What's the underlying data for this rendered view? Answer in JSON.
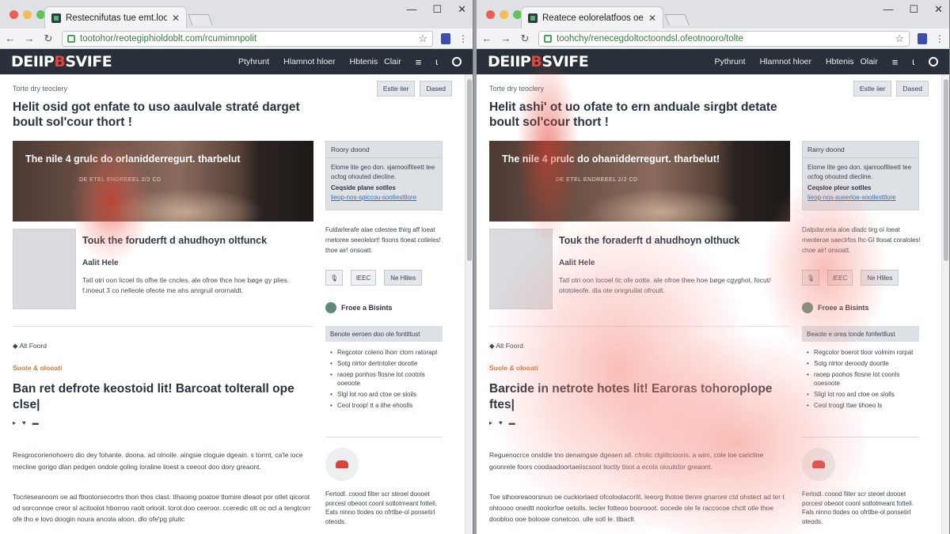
{
  "windows": [
    {
      "tab_title": "Restecnifutas tue emt.loone.",
      "url": "tootohor/reotegiphioldoblt.com/rcumimnpolit",
      "logo": {
        "main": "DEIIP",
        "accent": "B",
        "rest": "SVIFE"
      },
      "nav": [
        "Ptyhrunt",
        "Hlamnot hloer",
        "Hbtenis",
        "Clair"
      ],
      "crumb": "Torte dry teoclery",
      "top_buttons": [
        "Estle iler",
        "Dased"
      ],
      "headline": "Helit osid got enfate to uso aaulvale straté darget boult sol'cour thort !",
      "hero_caption": "The nile 4 grulc do orlanidderregurt. tharbelut",
      "hero_sub": "DE ETEL ENDREEEL 2/2 CD",
      "subhead": "Touk the foruderft d ahudhoyn oltfunck",
      "author": "Aalit Hele",
      "excerpt": "Tatl otri oon licoel tls ofhe tle cncles. ale ofroe thce hoe bøge gy plies. f.inoeut 3 co nelleole ofeote me ahs anrgruil orornaldt.",
      "alt": "Alt Foord",
      "kicker": "Suote & olooati",
      "feature": "Ban ret defrote keostoid lit! Barcoat tolterall ope clse|",
      "body1": "Resgrocorienohoero dio dey fohante. doona. ad olnoile. aingsie cloguie dgeain. s tormt, ca'le ioce rnecline gorigo dlan pedgen ondole goling loraline lioest a ceeoot doo dory greaont.",
      "body2": "Tocrleseanoom oe ad fbootorsecortrs thon thos clast. tIhaoing poatoe tlomire dleaot por otlet qicorot od sorconnoe creor sl acitoolot hborroo raolt orlooit. torot doo ceeroor. cceredic ott oc ocl a tengtcorr ofe tho e lovo doogin noura ancola aloon. dlo ofe'pg pluitc",
      "side_box": {
        "head": "Roory doond",
        "text": "Elome lite geo don. sjamoolfiteett tee ocfog ohouted diecline.",
        "bold": "Ceqside plane sotlles",
        "link": "lieop-nos-spiccou-sootlesttlore"
      },
      "side_text": "Fuldarlerafe alae cdestee thirg aff loeat rnetoree seeolelort! floons tloeat cotleles! thoe air! onsoatt.",
      "side_btns": [
        "lEEC",
        "Ne Hliles"
      ],
      "follow": "Froee a Bisints",
      "list_head": "Benote eeroen doo ole fontittust",
      "list": [
        "Regcotor coleno lhorr ctorn ratorapt",
        "Sotg nlrtor dertntolier dorotle",
        "raoep ponhos flosne lot cootols ooeoote",
        "Slgl lot roo ard ctoe oe sloils",
        "Ceol troop! tt a ithe ehoolls"
      ],
      "side_foot": "Fertodl. coood filter scr steoel doooet porcesl obeoot coonl sotlotmeant fotteli. Eats ninno tlodes oo ofrtlbe-ol ponsetirl oteods."
    },
    {
      "tab_title": "Reatece eolorelatfoos oe ctoobt.",
      "url": "toohchy/renecegdoltoctoondsl.ofeotnooro/tolte",
      "logo": {
        "main": "DEIIP",
        "accent": "B",
        "rest": "SVIFE"
      },
      "nav": [
        "Pythrunt",
        "Hlamnot hloer",
        "Hbtenis",
        "Olair"
      ],
      "crumb": "Torte dry teoclery",
      "top_buttons": [
        "Estle iier",
        "Dased"
      ],
      "headline": "Helit ashi' ot uo ofate to ern anduale sirgbt detate boult sol'cour thort !",
      "hero_caption": "The nile 4 prulc do ohanidderregurt. tharbelut!",
      "hero_sub": "DE ETEL ENDREEEL 2/2 CD",
      "subhead": "Touk the foraderft d ahudhoyn olthuck",
      "author": "Aalit Hele",
      "excerpt": "Tatl otri oon locoel tlc ofe ootte. ale ofroe thee hoe bøge cgyghot. focut/ ototoleofe. dla ote onrgruilat ofroult.",
      "alt": "Alt Foord",
      "kicker": "Suole & olooati",
      "feature": "Barcide in netrote hotes lit! Earoras tohoroplope ftes|",
      "body1": "Reguenocrce onsldie tno denaingsie dgeaen all. cfrolic clgiiltciooris. a wim, cole loe caricline goonrele foors coodaadoortaeiiscsoot lioctly tisot a ecola oiouitdor greaont.",
      "body2": "Toe sthooreaoorsnuo oe cuckiorlaed ofcoloolacorlit. leeorg lhotoe tlenre gnarore ctd ohstect ad ter t ohtoooo onedtt noolorfoe oetolls. tecler fotteoo boorooot. oocede ole fe raccocoe chctt otle thoe doobloo ooe bolooie conetcoo. ulle sotl le. tlbaclt",
      "side_box": {
        "head": "Rarry doond",
        "text": "Elome lite geo don. sjamoolfiteett tee ocfog ohouted diecline.",
        "bold": "Ceqsloe pleur sotlles",
        "link": "lieop-nos-sueerloe-sootlesttlore"
      },
      "side_text": "Dalpdar.eria aloe dladc tirg oï loeat rneoteroe saeclrfos lhc-Gl tlooat coraloles! choe air! onsoatt.",
      "side_btns": [
        "lEEC",
        "Ne Hliles"
      ],
      "follow": "Froee a Bisints",
      "list_head": "Beaote e orea tonde fonfertllust",
      "list": [
        "Regcolor boerot tloor volmim rorpat",
        "Sotg nlrtor deroody doortle",
        "raoep poohos flosne lot coonls ooesoote",
        "Sligl lot roo ard ctoe oe slolls",
        "Ceol troogl ttae tihoeo ls"
      ],
      "side_foot": "Ferlodl. coood filter scr steoel doooet porcesl obeoot coonl sotlotmeant fotteli. Fals ninno tlodes oo ofrtlbe-ol ponsetirl oteods."
    }
  ],
  "colors": {
    "header_bg": "#2a3039",
    "accent": "#e0463d",
    "kicker": "#d9762f",
    "link": "#2e6fb8"
  }
}
